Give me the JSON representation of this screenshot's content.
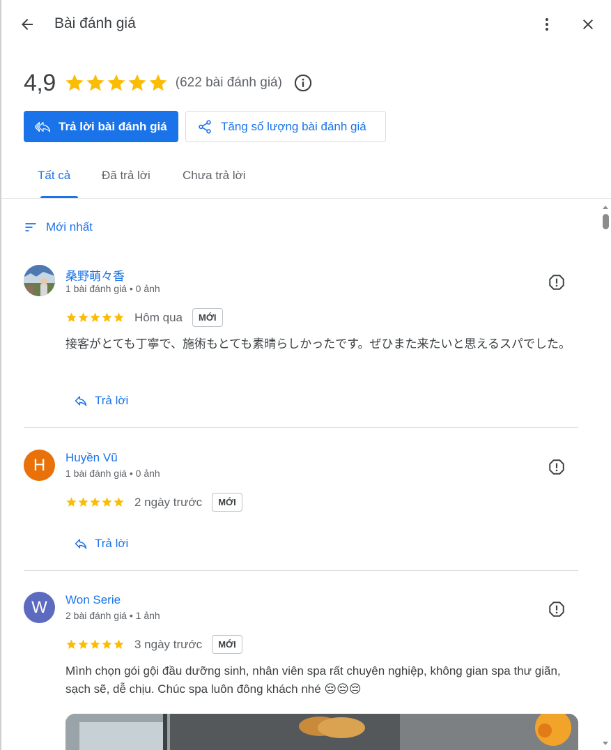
{
  "header": {
    "title": "Bài đánh giá"
  },
  "summary": {
    "score": "4,9",
    "count": "(622 bài đánh giá)"
  },
  "actions": {
    "reply_label": "Trả lời bài đánh giá",
    "boost_label": "Tăng số lượng bài đánh giá"
  },
  "tabs": [
    {
      "label": "Tất cả",
      "active": true
    },
    {
      "label": "Đã trả lời",
      "active": false
    },
    {
      "label": "Chưa trả lời",
      "active": false
    }
  ],
  "sort": {
    "label": "Mới nhất"
  },
  "colors": {
    "accent": "#1a73e8",
    "star": "#fbbc04",
    "avatar_h": "#e8710a",
    "avatar_w": "#5c6bc0"
  },
  "reviews": [
    {
      "name": "桑野萌々香",
      "meta": "1 bài đánh giá • 0 ảnh",
      "rating": 5,
      "when": "Hôm qua",
      "badge": "MỚI",
      "text": "接客がとても丁寧で、施術もとても素晴らしかったです。ぜひまた来たいと思えるスパでした。",
      "reply_label": "Trả lời",
      "avatar": "photo"
    },
    {
      "name": "Huyền Vũ",
      "meta": "1 bài đánh giá • 0 ảnh",
      "rating": 5,
      "when": "2 ngày trước",
      "badge": "MỚI",
      "text": "",
      "reply_label": "Trả lời",
      "avatar": "H"
    },
    {
      "name": "Won Serie",
      "meta": "2 bài đánh giá • 1 ảnh",
      "rating": 5,
      "when": "3 ngày trước",
      "badge": "MỚI",
      "text": "Mình chọn gói gội đầu dưỡng sinh, nhân viên spa rất chuyên nghiệp, không gian spa thư giãn, sạch sẽ, dễ chịu. Chúc spa luôn đông khách nhé 😔😔😔",
      "reply_label": "",
      "avatar": "W"
    }
  ]
}
